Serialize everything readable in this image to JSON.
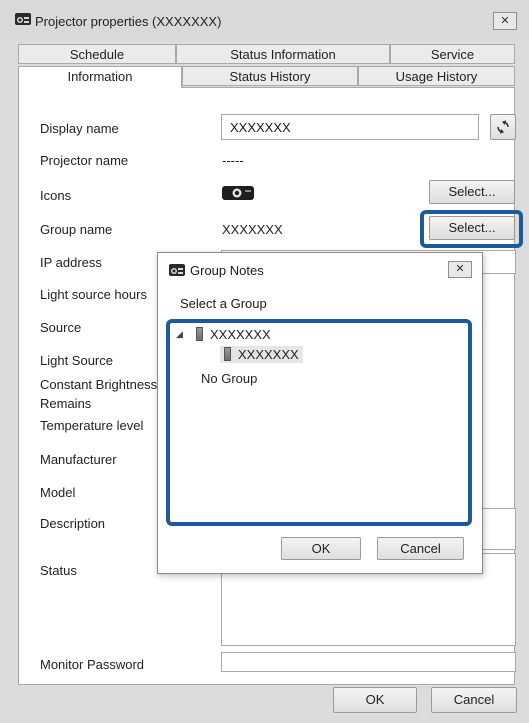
{
  "window": {
    "title": "Projector properties (XXXXXXX)",
    "close_glyph": "✕",
    "icon": "projector-properties-icon"
  },
  "tabs": {
    "row1": [
      "Schedule",
      "Status Information",
      "Service"
    ],
    "row2": [
      "Information",
      "Status History",
      "Usage History"
    ],
    "active": "Information"
  },
  "fields": {
    "display_name": {
      "label": "Display name",
      "value": "XXXXXXX"
    },
    "projector_name": {
      "label": "Projector name",
      "value": "-----"
    },
    "icons": {
      "label": "Icons",
      "button": "Select..."
    },
    "group_name": {
      "label": "Group name",
      "value": "XXXXXXX",
      "button": "Select..."
    },
    "ip_address": {
      "label": "IP address"
    },
    "light_source_hours": {
      "label": "Light source hours"
    },
    "source": {
      "label": "Source"
    },
    "light_source": {
      "label": "Light Source"
    },
    "constant_brightness_line1": {
      "label": "Constant Brightness"
    },
    "constant_brightness_line2": {
      "label": "Remains"
    },
    "temperature_level": {
      "label": "Temperature level"
    },
    "manufacturer": {
      "label": "Manufacturer"
    },
    "model": {
      "label": "Model"
    },
    "description": {
      "label": "Description"
    },
    "status": {
      "label": "Status"
    },
    "monitor_password": {
      "label": "Monitor Password"
    }
  },
  "footer": {
    "ok": "OK",
    "cancel": "Cancel"
  },
  "dialog": {
    "title": "Group Notes",
    "close_glyph": "✕",
    "prompt": "Select a Group",
    "tree": {
      "expander": "◢",
      "root": "XXXXXXX",
      "child": "XXXXXXX",
      "no_group": "No Group"
    },
    "ok": "OK",
    "cancel": "Cancel"
  },
  "colors": {
    "highlight": "#1d5a9b",
    "window_bg": "#dcdcdc"
  }
}
